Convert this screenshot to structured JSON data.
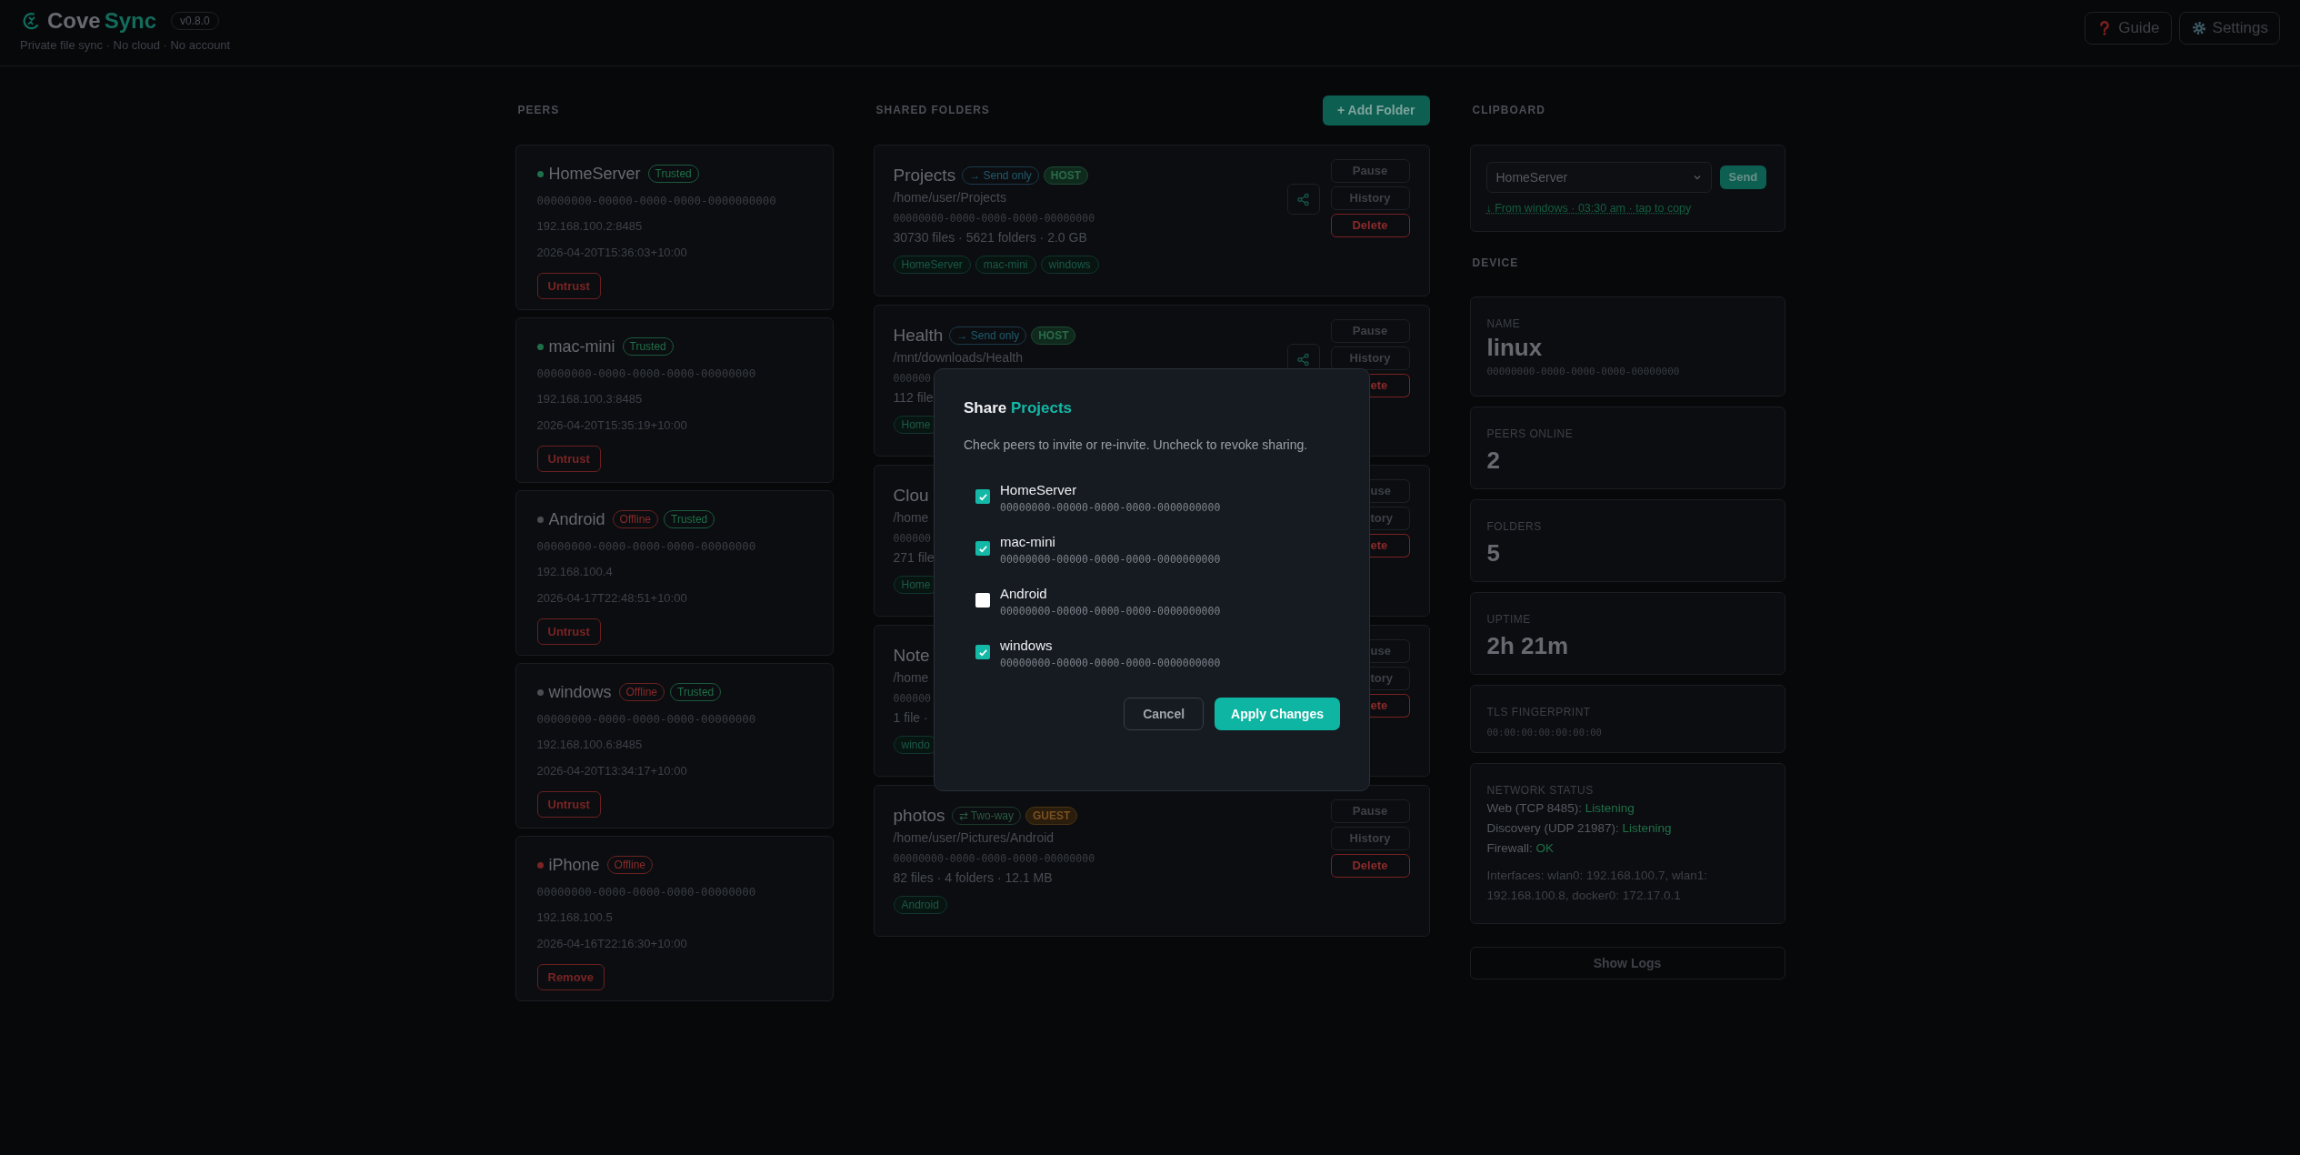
{
  "header": {
    "brand_first": "Cove",
    "brand_second": "Sync",
    "version": "v0.8.0",
    "tagline": "Private file sync · No cloud · No account",
    "buttons": [
      {
        "kind": "help",
        "label": "Guide"
      },
      {
        "kind": "settings",
        "label": "Settings"
      }
    ]
  },
  "peers": {
    "heading": "PEERS",
    "items": [
      {
        "name": "HomeServer",
        "color": "#1f6f4a",
        "badges": [
          {
            "kind": "trusted",
            "label": "Trusted"
          }
        ],
        "id": "00000000-00000-0000-0000-0000000000",
        "address": "192.168.100.2:8485",
        "last_seen": "2026-04-20T15:36:03+10:00",
        "action": "Untrust"
      },
      {
        "name": "mac-mini",
        "color": "#1f6f4a",
        "badges": [
          {
            "kind": "trusted",
            "label": "Trusted"
          }
        ],
        "id": "00000000-0000-0000-0000-00000000",
        "address": "192.168.100.3:8485",
        "last_seen": "2026-04-20T15:35:19+10:00",
        "action": "Untrust"
      },
      {
        "name": "Android",
        "color": "#4a4d52",
        "badges": [
          {
            "kind": "offline",
            "label": "Offline"
          },
          {
            "kind": "trusted",
            "label": "Trusted"
          }
        ],
        "id": "00000000-0000-0000-0000-00000000",
        "address": "192.168.100.4",
        "last_seen": "2026-04-17T22:48:51+10:00",
        "action": "Untrust"
      },
      {
        "name": "windows",
        "color": "#4a4d52",
        "badges": [
          {
            "kind": "offline",
            "label": "Offline"
          },
          {
            "kind": "trusted",
            "label": "Trusted"
          }
        ],
        "id": "00000000-0000-0000-0000-00000000",
        "address": "192.168.100.6:8485",
        "last_seen": "2026-04-20T13:34:17+10:00",
        "action": "Untrust"
      },
      {
        "name": "iPhone",
        "color": "#7a2424",
        "badges": [
          {
            "kind": "offline",
            "label": "Offline"
          }
        ],
        "id": "00000000-0000-0000-0000-00000000",
        "address": "192.168.100.5",
        "last_seen": "2026-04-16T22:16:30+10:00",
        "action": "Remove"
      }
    ]
  },
  "folders": {
    "heading": "SHARED FOLDERS",
    "add_button": "+ Add Folder",
    "items": [
      {
        "name": "Projects",
        "badges": [
          {
            "kind": "send_only",
            "label": "→ Send only"
          },
          {
            "kind": "host",
            "label": "HOST"
          }
        ],
        "path": "/home/user/Projects",
        "id": "00000000-0000-0000-0000-00000000",
        "stats": "30730 files · 5621 folders · 2.0 GB",
        "tags": [
          "HomeServer",
          "mac-mini",
          "windows"
        ],
        "share": true,
        "buttons": [
          {
            "kind": "neutral",
            "label": "Pause"
          },
          {
            "kind": "neutral",
            "label": "History"
          },
          {
            "kind": "danger",
            "label": "Delete"
          }
        ]
      },
      {
        "name": "Health",
        "badges": [
          {
            "kind": "send_only",
            "label": "→ Send only"
          },
          {
            "kind": "host",
            "label": "HOST"
          }
        ],
        "path": "/mnt/downloads/Health",
        "id": "000000",
        "stats": "112 file",
        "tags": [
          "Home"
        ],
        "share": true,
        "buttons": [
          {
            "kind": "neutral",
            "label": "Pause"
          },
          {
            "kind": "neutral",
            "label": "History"
          },
          {
            "kind": "danger",
            "label": "ete",
            "partial": true
          }
        ]
      },
      {
        "name": "Clou",
        "path": "/home",
        "id": "000000",
        "stats": "271 file",
        "tags": [
          "Home"
        ],
        "share": false,
        "buttons": [
          {
            "kind": "neutral",
            "label": "use",
            "partial": true
          },
          {
            "kind": "neutral",
            "label": "tory",
            "partial": true
          },
          {
            "kind": "danger",
            "label": "ete",
            "partial": true
          }
        ]
      },
      {
        "name": "Note",
        "path": "/home",
        "id": "000000",
        "stats": "1 file ·",
        "tags": [
          "windo"
        ],
        "share": false,
        "buttons": [
          {
            "kind": "neutral",
            "label": "use",
            "partial": true
          },
          {
            "kind": "neutral",
            "label": "tory",
            "partial": true
          },
          {
            "kind": "danger",
            "label": "ete",
            "partial": true
          }
        ]
      },
      {
        "name": "photos",
        "badges": [
          {
            "kind": "two_way",
            "label": "⇄ Two-way"
          },
          {
            "kind": "guest",
            "label": "GUEST"
          }
        ],
        "path": "/home/user/Pictures/Android",
        "id": "00000000-0000-0000-0000-00000000",
        "stats": "82 files · 4 folders · 12.1 MB",
        "tags": [
          "Android"
        ],
        "share": false,
        "buttons": [
          {
            "kind": "neutral",
            "label": "Pause"
          },
          {
            "kind": "neutral",
            "label": "History"
          },
          {
            "kind": "danger",
            "label": "Delete"
          }
        ]
      }
    ]
  },
  "clipboard": {
    "heading": "CLIPBOARD",
    "target": "HomeServer",
    "send_button": "Send",
    "received_link": "↓ From windows · 03:30 am · tap to copy"
  },
  "device": {
    "heading": "DEVICE",
    "name_label": "NAME",
    "name": "linux",
    "id": "00000000-0000-0000-0000-00000000",
    "stats": [
      {
        "label": "PEERS ONLINE",
        "value": "2"
      },
      {
        "label": "FOLDERS",
        "value": "5"
      },
      {
        "label": "UPTIME",
        "value": "2h 21m"
      }
    ],
    "tls_label": "TLS FINGERPRINT",
    "tls_fingerprint": "00:00:00:00:00:00:00",
    "network_label": "NETWORK STATUS",
    "network": [
      {
        "label": "Web (TCP 8485):",
        "value": "Listening"
      },
      {
        "label": "Discovery (UDP 21987):",
        "value": "Listening"
      },
      {
        "label": "Firewall:",
        "value": "OK"
      }
    ],
    "interfaces": "Interfaces: wlan0: 192.168.100.7, wlan1: 192.168.100.8, docker0: 172.17.0.1",
    "logs_button": "Show Logs"
  },
  "modal": {
    "title_prefix": "Share",
    "title_folder": "Projects",
    "description": "Check peers to invite or re-invite. Uncheck to revoke sharing.",
    "peers": [
      {
        "name": "HomeServer",
        "id": "00000000-00000-0000-0000-0000000000",
        "checked": true
      },
      {
        "name": "mac-mini",
        "id": "00000000-00000-0000-0000-0000000000",
        "checked": true
      },
      {
        "name": "Android",
        "id": "00000000-00000-0000-0000-0000000000",
        "checked": false
      },
      {
        "name": "windows",
        "id": "00000000-00000-0000-0000-0000000000",
        "checked": true
      }
    ],
    "cancel_button": "Cancel",
    "apply_button": "Apply Changes"
  }
}
